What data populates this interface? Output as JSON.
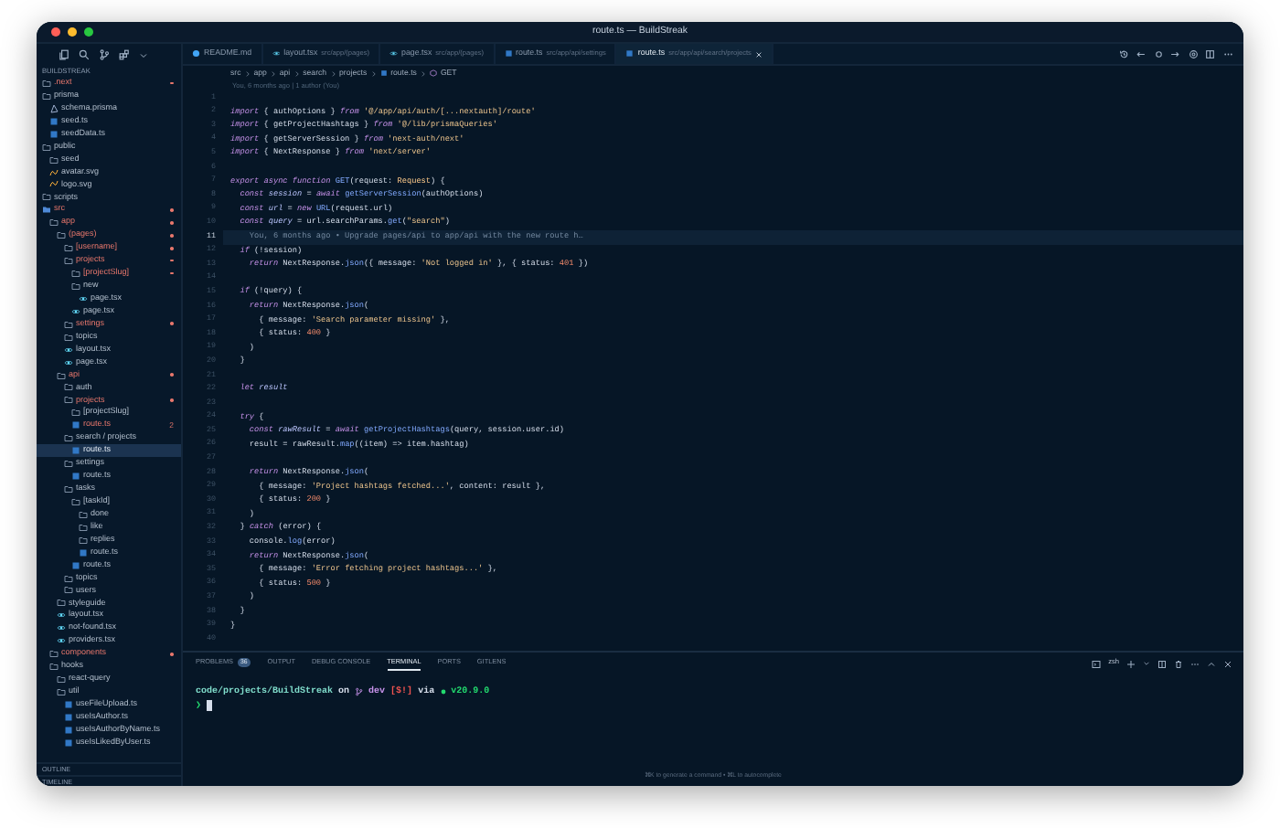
{
  "window": {
    "title": "route.ts — BuildStreak"
  },
  "explorer": {
    "title": "BUILDSTREAK",
    "tree": [
      {
        "label": ".next",
        "kind": "folder",
        "modified": true,
        "selected": false
      },
      {
        "label": "prisma",
        "kind": "folder",
        "modified": false,
        "selected": false,
        "children": [
          {
            "label": "schema.prisma",
            "kind": "prisma",
            "modified": false,
            "selected": false
          },
          {
            "label": "seed.ts",
            "kind": "ts",
            "modified": false,
            "selected": false
          },
          {
            "label": "seedData.ts",
            "kind": "ts",
            "modified": false,
            "selected": false
          }
        ]
      },
      {
        "label": "public",
        "kind": "folder",
        "modified": false,
        "selected": false,
        "children": [
          {
            "label": "seed",
            "kind": "folder",
            "modified": false,
            "selected": false
          },
          {
            "label": "avatar.svg",
            "kind": "svg",
            "modified": false,
            "selected": false
          },
          {
            "label": "logo.svg",
            "kind": "svg",
            "modified": false,
            "selected": false
          }
        ]
      },
      {
        "label": "scripts",
        "kind": "folder",
        "modified": false,
        "selected": false
      },
      {
        "label": "src",
        "kind": "src",
        "modified": true,
        "selected": false,
        "children": [
          {
            "label": "app",
            "kind": "folder",
            "modified": true,
            "selected": false,
            "children": [
              {
                "label": "(pages)",
                "kind": "folder",
                "modified": true,
                "selected": false,
                "children": [
                  {
                    "label": "[username]",
                    "kind": "folder",
                    "modified": true,
                    "selected": false
                  },
                  {
                    "label": "projects",
                    "kind": "folder",
                    "modified": true,
                    "selected": false,
                    "children": [
                      {
                        "label": "[projectSlug]",
                        "kind": "folder",
                        "modified": true,
                        "selected": false
                      },
                      {
                        "label": "new",
                        "kind": "folder",
                        "modified": false,
                        "selected": false,
                        "children": [
                          {
                            "label": "page.tsx",
                            "kind": "tsx",
                            "modified": false,
                            "selected": false
                          }
                        ]
                      },
                      {
                        "label": "page.tsx",
                        "kind": "tsx",
                        "modified": false,
                        "selected": false
                      }
                    ]
                  },
                  {
                    "label": "settings",
                    "kind": "folder",
                    "modified": true,
                    "selected": false
                  },
                  {
                    "label": "topics",
                    "kind": "folder",
                    "modified": false,
                    "selected": false
                  },
                  {
                    "label": "layout.tsx",
                    "kind": "tsx",
                    "modified": false,
                    "selected": false
                  },
                  {
                    "label": "page.tsx",
                    "kind": "tsx",
                    "modified": false,
                    "selected": false
                  }
                ]
              },
              {
                "label": "api",
                "kind": "folder",
                "modified": true,
                "selected": false,
                "children": [
                  {
                    "label": "auth",
                    "kind": "folder",
                    "modified": false,
                    "selected": false
                  },
                  {
                    "label": "projects",
                    "kind": "folder",
                    "modified": true,
                    "selected": false,
                    "children": [
                      {
                        "label": "[projectSlug]",
                        "kind": "folder",
                        "modified": false,
                        "selected": false
                      },
                      {
                        "label": "route.ts",
                        "kind": "ts",
                        "modified": true,
                        "problems": "2",
                        "selected": false
                      }
                    ]
                  },
                  {
                    "label": "search / projects",
                    "kind": "folder",
                    "modified": false,
                    "selected": false,
                    "children": [
                      {
                        "label": "route.ts",
                        "kind": "ts",
                        "modified": false,
                        "selected": true
                      }
                    ]
                  },
                  {
                    "label": "settings",
                    "kind": "folder",
                    "modified": false,
                    "selected": false,
                    "children": [
                      {
                        "label": "route.ts",
                        "kind": "ts",
                        "modified": false,
                        "selected": false
                      }
                    ]
                  },
                  {
                    "label": "tasks",
                    "kind": "folder",
                    "modified": false,
                    "selected": false,
                    "children": [
                      {
                        "label": "[taskId]",
                        "kind": "folder",
                        "modified": false,
                        "selected": false,
                        "children": [
                          {
                            "label": "done",
                            "kind": "folder",
                            "modified": false,
                            "selected": false
                          },
                          {
                            "label": "like",
                            "kind": "folder",
                            "modified": false,
                            "selected": false
                          },
                          {
                            "label": "replies",
                            "kind": "folder",
                            "modified": false,
                            "selected": false
                          },
                          {
                            "label": "route.ts",
                            "kind": "ts",
                            "modified": false,
                            "selected": false
                          }
                        ]
                      },
                      {
                        "label": "route.ts",
                        "kind": "ts",
                        "modified": false,
                        "selected": false
                      }
                    ]
                  },
                  {
                    "label": "topics",
                    "kind": "folder",
                    "modified": false,
                    "selected": false
                  },
                  {
                    "label": "users",
                    "kind": "folder",
                    "modified": false,
                    "selected": false
                  }
                ]
              },
              {
                "label": "styleguide",
                "kind": "folder",
                "modified": false,
                "selected": false
              },
              {
                "label": "layout.tsx",
                "kind": "tsx",
                "modified": false,
                "selected": false
              },
              {
                "label": "not-found.tsx",
                "kind": "tsx",
                "modified": false,
                "selected": false
              },
              {
                "label": "providers.tsx",
                "kind": "tsx",
                "modified": false,
                "selected": false
              }
            ]
          },
          {
            "label": "components",
            "kind": "folder",
            "modified": true,
            "selected": false
          },
          {
            "label": "hooks",
            "kind": "folder",
            "modified": false,
            "selected": false,
            "children": [
              {
                "label": "react-query",
                "kind": "folder",
                "modified": false,
                "selected": false
              },
              {
                "label": "util",
                "kind": "folder",
                "modified": false,
                "selected": false,
                "children": [
                  {
                    "label": "useFileUpload.ts",
                    "kind": "ts",
                    "modified": false,
                    "selected": false
                  },
                  {
                    "label": "useIsAuthor.ts",
                    "kind": "ts",
                    "modified": false,
                    "selected": false
                  },
                  {
                    "label": "useIsAuthorByName.ts",
                    "kind": "ts",
                    "modified": false,
                    "selected": false
                  },
                  {
                    "label": "useIsLikedByUser.ts",
                    "kind": "ts",
                    "modified": false,
                    "selected": false
                  }
                ]
              }
            ]
          }
        ]
      }
    ],
    "sections": [
      "OUTLINE",
      "TIMELINE"
    ]
  },
  "tabs": [
    {
      "label": "README.md",
      "kind": "md",
      "selected": false
    },
    {
      "label": "layout.tsx",
      "path": "src/app/(pages)",
      "kind": "tsx",
      "selected": false
    },
    {
      "label": "page.tsx",
      "path": "src/app/(pages)",
      "kind": "tsx",
      "selected": false
    },
    {
      "label": "route.ts",
      "path": "src/app/api/settings",
      "kind": "ts",
      "selected": false
    },
    {
      "label": "route.ts",
      "path": "src/app/api/search/projects",
      "kind": "ts",
      "selected": true
    }
  ],
  "breadcrumb": [
    {
      "label": "src",
      "kind": "folder"
    },
    {
      "label": "app",
      "kind": "folder"
    },
    {
      "label": "api",
      "kind": "folder"
    },
    {
      "label": "search",
      "kind": "folder"
    },
    {
      "label": "projects",
      "kind": "folder"
    },
    {
      "label": "route.ts",
      "kind": "ts"
    },
    {
      "label": "GET",
      "kind": "symbol"
    }
  ],
  "blame": "You, 6 months ago | 1 author (You)",
  "code": [
    {
      "number": "1",
      "current": false
    },
    {
      "number": "2",
      "current": false,
      "tokens": [
        {
          "kind": "keyword",
          "text": "import"
        },
        {
          "kind": "plain",
          "text": " { authOptions } "
        },
        {
          "kind": "keyword",
          "text": "from"
        },
        {
          "kind": "string",
          "text": " '@/app/api/auth/[...nextauth]/route'"
        }
      ]
    },
    {
      "number": "3",
      "current": false,
      "tokens": [
        {
          "kind": "keyword",
          "text": "import"
        },
        {
          "kind": "plain",
          "text": " { getProjectHashtags } "
        },
        {
          "kind": "keyword",
          "text": "from"
        },
        {
          "kind": "string",
          "text": " '@/lib/prismaQueries'"
        }
      ]
    },
    {
      "number": "4",
      "current": false,
      "tokens": [
        {
          "kind": "keyword",
          "text": "import"
        },
        {
          "kind": "plain",
          "text": " { getServerSession } "
        },
        {
          "kind": "keyword",
          "text": "from"
        },
        {
          "kind": "string",
          "text": " 'next-auth/next'"
        }
      ]
    },
    {
      "number": "5",
      "current": false,
      "tokens": [
        {
          "kind": "keyword",
          "text": "import"
        },
        {
          "kind": "plain",
          "text": " { NextResponse } "
        },
        {
          "kind": "keyword",
          "text": "from"
        },
        {
          "kind": "string",
          "text": " 'next/server'"
        }
      ]
    },
    {
      "number": "6",
      "current": false
    },
    {
      "number": "7",
      "current": false,
      "tokens": [
        {
          "kind": "keyword",
          "text": "export async function"
        },
        {
          "kind": "function",
          "text": " GET"
        },
        {
          "kind": "plain",
          "text": "(request: "
        },
        {
          "kind": "type",
          "text": "Request"
        },
        {
          "kind": "plain",
          "text": ") {"
        }
      ]
    },
    {
      "number": "8",
      "current": false,
      "tokens": [
        {
          "kind": "keyword",
          "text": "  const"
        },
        {
          "kind": "variable",
          "text": " session"
        },
        {
          "kind": "plain",
          "text": " = "
        },
        {
          "kind": "keyword",
          "text": "await"
        },
        {
          "kind": "function",
          "text": " getServerSession"
        },
        {
          "kind": "plain",
          "text": "(authOptions)"
        }
      ]
    },
    {
      "number": "9",
      "current": false,
      "tokens": [
        {
          "kind": "keyword",
          "text": "  const"
        },
        {
          "kind": "variable",
          "text": " url"
        },
        {
          "kind": "plain",
          "text": " = "
        },
        {
          "kind": "keyword",
          "text": "new"
        },
        {
          "kind": "function",
          "text": " URL"
        },
        {
          "kind": "plain",
          "text": "(request.url)"
        }
      ]
    },
    {
      "number": "10",
      "current": false,
      "tokens": [
        {
          "kind": "keyword",
          "text": "  const"
        },
        {
          "kind": "variable",
          "text": " query"
        },
        {
          "kind": "plain",
          "text": " = url.searchParams."
        },
        {
          "kind": "function",
          "text": "get"
        },
        {
          "kind": "plain",
          "text": "("
        },
        {
          "kind": "string",
          "text": "\"search\""
        },
        {
          "kind": "plain",
          "text": ")"
        }
      ]
    },
    {
      "number": "11",
      "current": true,
      "tokens": [
        {
          "kind": "blame",
          "text": "    You, 6 months ago • Upgrade pages/api to app/api with the new route h…"
        }
      ]
    },
    {
      "number": "12",
      "current": false,
      "tokens": [
        {
          "kind": "keyword",
          "text": "  if"
        },
        {
          "kind": "plain",
          "text": " (!session)"
        }
      ]
    },
    {
      "number": "13",
      "current": false,
      "tokens": [
        {
          "kind": "keyword",
          "text": "    return"
        },
        {
          "kind": "plain",
          "text": " NextResponse."
        },
        {
          "kind": "function",
          "text": "json"
        },
        {
          "kind": "plain",
          "text": "({ message: "
        },
        {
          "kind": "string",
          "text": "'Not logged in'"
        },
        {
          "kind": "plain",
          "text": " }, { status: "
        },
        {
          "kind": "number",
          "text": "401"
        },
        {
          "kind": "plain",
          "text": " })"
        }
      ]
    },
    {
      "number": "14",
      "current": false
    },
    {
      "number": "15",
      "current": false,
      "tokens": [
        {
          "kind": "keyword",
          "text": "  if"
        },
        {
          "kind": "plain",
          "text": " (!query) {"
        }
      ]
    },
    {
      "number": "16",
      "current": false,
      "tokens": [
        {
          "kind": "keyword",
          "text": "    return"
        },
        {
          "kind": "plain",
          "text": " NextResponse."
        },
        {
          "kind": "function",
          "text": "json"
        },
        {
          "kind": "plain",
          "text": "("
        }
      ]
    },
    {
      "number": "17",
      "current": false,
      "tokens": [
        {
          "kind": "plain",
          "text": "      { message: "
        },
        {
          "kind": "string",
          "text": "'Search parameter missing'"
        },
        {
          "kind": "plain",
          "text": " },"
        }
      ]
    },
    {
      "number": "18",
      "current": false,
      "tokens": [
        {
          "kind": "plain",
          "text": "      { status: "
        },
        {
          "kind": "number",
          "text": "400"
        },
        {
          "kind": "plain",
          "text": " }"
        }
      ]
    },
    {
      "number": "19",
      "current": false,
      "tokens": [
        {
          "kind": "plain",
          "text": "    )"
        }
      ]
    },
    {
      "number": "20",
      "current": false,
      "tokens": [
        {
          "kind": "plain",
          "text": "  }"
        }
      ]
    },
    {
      "number": "21",
      "current": false
    },
    {
      "number": "22",
      "current": false,
      "tokens": [
        {
          "kind": "keyword",
          "text": "  let"
        },
        {
          "kind": "variable",
          "text": " result"
        }
      ]
    },
    {
      "number": "23",
      "current": false
    },
    {
      "number": "24",
      "current": false,
      "tokens": [
        {
          "kind": "keyword",
          "text": "  try"
        },
        {
          "kind": "plain",
          "text": " {"
        }
      ]
    },
    {
      "number": "25",
      "current": false,
      "tokens": [
        {
          "kind": "keyword",
          "text": "    const"
        },
        {
          "kind": "variable",
          "text": " rawResult"
        },
        {
          "kind": "plain",
          "text": " = "
        },
        {
          "kind": "keyword",
          "text": "await"
        },
        {
          "kind": "function",
          "text": " getProjectHashtags"
        },
        {
          "kind": "plain",
          "text": "(query, session.user.id)"
        }
      ]
    },
    {
      "number": "26",
      "current": false,
      "tokens": [
        {
          "kind": "plain",
          "text": "    result = rawResult."
        },
        {
          "kind": "function",
          "text": "map"
        },
        {
          "kind": "plain",
          "text": "((item) => item.hashtag)"
        }
      ]
    },
    {
      "number": "27",
      "current": false
    },
    {
      "number": "28",
      "current": false,
      "tokens": [
        {
          "kind": "keyword",
          "text": "    return"
        },
        {
          "kind": "plain",
          "text": " NextResponse."
        },
        {
          "kind": "function",
          "text": "json"
        },
        {
          "kind": "plain",
          "text": "("
        }
      ]
    },
    {
      "number": "29",
      "current": false,
      "tokens": [
        {
          "kind": "plain",
          "text": "      { message: "
        },
        {
          "kind": "string",
          "text": "'Project hashtags fetched...'"
        },
        {
          "kind": "plain",
          "text": ", content: result },"
        }
      ]
    },
    {
      "number": "30",
      "current": false,
      "tokens": [
        {
          "kind": "plain",
          "text": "      { status: "
        },
        {
          "kind": "number",
          "text": "200"
        },
        {
          "kind": "plain",
          "text": " }"
        }
      ]
    },
    {
      "number": "31",
      "current": false,
      "tokens": [
        {
          "kind": "plain",
          "text": "    )"
        }
      ]
    },
    {
      "number": "32",
      "current": false,
      "tokens": [
        {
          "kind": "plain",
          "text": "  } "
        },
        {
          "kind": "keyword",
          "text": "catch"
        },
        {
          "kind": "plain",
          "text": " (error) {"
        }
      ]
    },
    {
      "number": "33",
      "current": false,
      "tokens": [
        {
          "kind": "plain",
          "text": "    console."
        },
        {
          "kind": "function",
          "text": "log"
        },
        {
          "kind": "plain",
          "text": "(error)"
        }
      ]
    },
    {
      "number": "34",
      "current": false,
      "tokens": [
        {
          "kind": "keyword",
          "text": "    return"
        },
        {
          "kind": "plain",
          "text": " NextResponse."
        },
        {
          "kind": "function",
          "text": "json"
        },
        {
          "kind": "plain",
          "text": "("
        }
      ]
    },
    {
      "number": "35",
      "current": false,
      "tokens": [
        {
          "kind": "plain",
          "text": "      { message: "
        },
        {
          "kind": "string",
          "text": "'Error fetching project hashtags...'"
        },
        {
          "kind": "plain",
          "text": " },"
        }
      ]
    },
    {
      "number": "36",
      "current": false,
      "tokens": [
        {
          "kind": "plain",
          "text": "      { status: "
        },
        {
          "kind": "number",
          "text": "500"
        },
        {
          "kind": "plain",
          "text": " }"
        }
      ]
    },
    {
      "number": "37",
      "current": false,
      "tokens": [
        {
          "kind": "plain",
          "text": "    )"
        }
      ]
    },
    {
      "number": "38",
      "current": false,
      "tokens": [
        {
          "kind": "plain",
          "text": "  }"
        }
      ]
    },
    {
      "number": "39",
      "current": false,
      "tokens": [
        {
          "kind": "plain",
          "text": "}"
        }
      ]
    },
    {
      "number": "40",
      "current": false
    }
  ],
  "panel": {
    "tabs": [
      {
        "label": "PROBLEMS",
        "badge": "36",
        "selected": false
      },
      {
        "label": "OUTPUT",
        "selected": false
      },
      {
        "label": "DEBUG CONSOLE",
        "selected": false
      },
      {
        "label": "TERMINAL",
        "selected": true
      },
      {
        "label": "PORTS",
        "selected": false
      },
      {
        "label": "GITLENS",
        "selected": false
      }
    ],
    "shell": "zsh",
    "prompt": [
      {
        "kind": "path",
        "text": "code/projects/BuildStreak"
      },
      {
        "kind": "plain",
        "text": "on"
      },
      {
        "kind": "branch",
        "text": "dev"
      },
      {
        "kind": "status",
        "text": "[$!]"
      },
      {
        "kind": "plain",
        "text": "via"
      },
      {
        "kind": "node",
        "text": "v20.9.0"
      }
    ],
    "input_symbol": "❯"
  },
  "status_bar": {
    "hint": "⌘K to generate a command • ⌘L to autocomplete"
  }
}
